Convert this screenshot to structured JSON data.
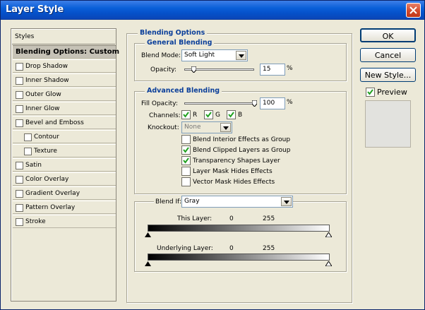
{
  "window": {
    "title": "Layer Style"
  },
  "styles": {
    "header": "Styles",
    "selected": "Blending Options: Custom",
    "items": [
      {
        "label": "Drop Shadow"
      },
      {
        "label": "Inner Shadow"
      },
      {
        "label": "Outer Glow"
      },
      {
        "label": "Inner Glow"
      },
      {
        "label": "Bevel and Emboss"
      },
      {
        "label": "Contour"
      },
      {
        "label": "Texture"
      },
      {
        "label": "Satin"
      },
      {
        "label": "Color Overlay"
      },
      {
        "label": "Gradient Overlay"
      },
      {
        "label": "Pattern Overlay"
      },
      {
        "label": "Stroke"
      }
    ]
  },
  "blending": {
    "title": "Blending Options",
    "general": {
      "title": "General Blending",
      "blend_mode_label": "Blend Mode:",
      "blend_mode_value": "Soft Light",
      "opacity_label": "Opacity:",
      "opacity_value": "15",
      "percent": "%"
    },
    "advanced": {
      "title": "Advanced Blending",
      "fill_opacity_label": "Fill Opacity:",
      "fill_opacity_value": "100",
      "percent": "%",
      "channels_label": "Channels:",
      "channel_r": "R",
      "channel_g": "G",
      "channel_b": "B",
      "knockout_label": "Knockout:",
      "knockout_value": "None",
      "options": [
        {
          "label": "Blend Interior Effects as Group",
          "checked": false
        },
        {
          "label": "Blend Clipped Layers as Group",
          "checked": true
        },
        {
          "label": "Transparency Shapes Layer",
          "checked": true
        },
        {
          "label": "Layer Mask Hides Effects",
          "checked": false
        },
        {
          "label": "Vector Mask Hides Effects",
          "checked": false
        }
      ]
    },
    "blend_if": {
      "label": "Blend If:",
      "value": "Gray",
      "this_layer": "This Layer:",
      "underlying_layer": "Underlying Layer:",
      "min": "0",
      "max": "255"
    }
  },
  "buttons": {
    "ok": "OK",
    "cancel": "Cancel",
    "new_style": "New Style...",
    "preview": "Preview",
    "preview_checked": true
  },
  "colors": {
    "accent_title": "#0b3f9a",
    "titlebar": "#0550c8",
    "check": "#21a121"
  }
}
